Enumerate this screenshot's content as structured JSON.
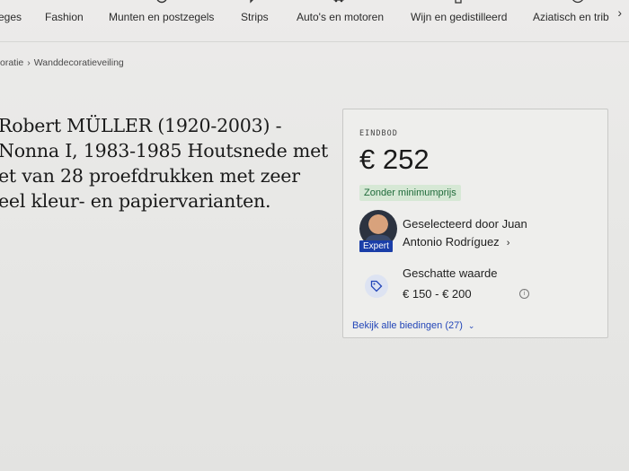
{
  "nav": {
    "items": [
      {
        "label": "eges",
        "icon": ""
      },
      {
        "label": "Fashion",
        "icon": ""
      },
      {
        "label": "Munten en postzegels",
        "icon": "coin-icon"
      },
      {
        "label": "Strips",
        "icon": "speech-bubble-icon"
      },
      {
        "label": "Auto's en motoren",
        "icon": "car-icon"
      },
      {
        "label": "Wijn en gedistilleerd",
        "icon": "bottle-icon"
      },
      {
        "label": "Aziatisch en trib",
        "icon": "mask-icon"
      }
    ],
    "next_icon": "chevron-right-icon",
    "next_glyph": "›"
  },
  "breadcrumb": {
    "items": [
      "oratie",
      "Wanddecoratieveiling"
    ],
    "separator": "›"
  },
  "lot": {
    "title_lines": [
      "Robert MÜLLER (1920-2003) -",
      "Nonna I, 1983-1985 Houtsnede met",
      "et van 28 proefdrukken met zeer",
      "eel kleur- en papiervarianten."
    ]
  },
  "bid_card": {
    "label": "EINDBOD",
    "amount": "€ 252",
    "no_reserve": "Zonder minimumprijs",
    "expert_badge": "Expert",
    "expert_line1": "Geselecteerd door Juan",
    "expert_line2": "Antonio Rodríguez",
    "chevron": "›",
    "estimate_label": "Geschatte waarde",
    "estimate_value": "€ 150 - € 200",
    "info_glyph": "i",
    "view_bids": "Bekijk alle biedingen (27)",
    "view_bids_chevron": "⌄",
    "colors": {
      "no_reserve_bg": "#d6e8d5",
      "no_reserve_text": "#1f6b3a",
      "expert_badge_bg": "#1a3ea8",
      "link": "#2346b8"
    }
  }
}
